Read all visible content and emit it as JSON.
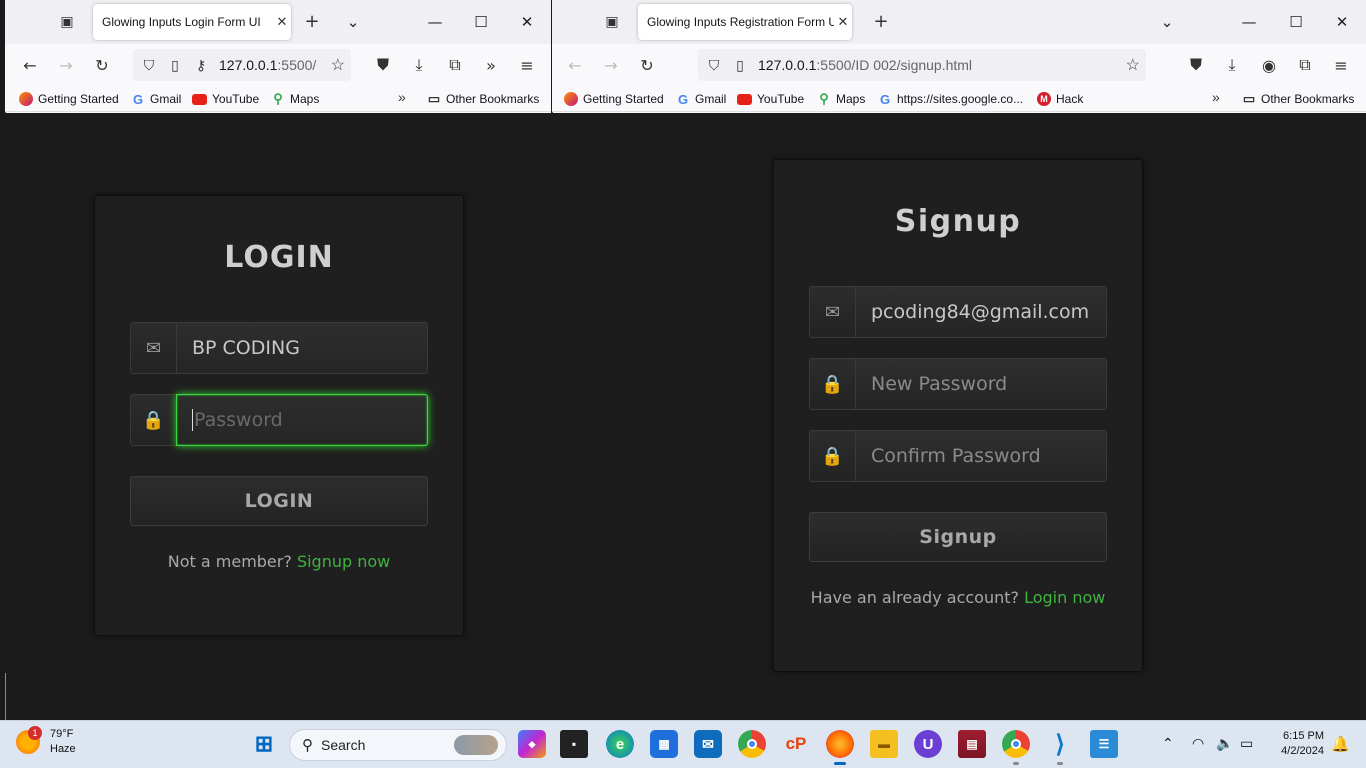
{
  "left_window": {
    "tab_title": "Glowing Inputs Login Form UI",
    "url_host": "127.0.0.1",
    "url_rest": ":5500/",
    "bookmarks": [
      "Getting Started",
      "Gmail",
      "YouTube",
      "Maps"
    ],
    "other_bookmarks": "Other Bookmarks",
    "form": {
      "title": "LOGIN",
      "username_value": "BP CODING",
      "password_placeholder": "Password",
      "button_label": "LOGIN",
      "footer_text": "Not a member? ",
      "footer_link": "Signup now"
    }
  },
  "right_window": {
    "tab_title": "Glowing Inputs Registration Form UI",
    "url_host": "127.0.0.1",
    "url_rest": ":5500/ID 002/signup.html",
    "bookmarks": [
      "Getting Started",
      "Gmail",
      "YouTube",
      "Maps",
      "https://sites.google.co...",
      "Hack"
    ],
    "other_bookmarks": "Other Bookmarks",
    "form": {
      "title": "Signup",
      "email_value": "pcoding84@gmail.com",
      "new_password_placeholder": "New Password",
      "confirm_password_placeholder": "Confirm Password",
      "button_label": "Signup",
      "footer_text": "Have an already account? ",
      "footer_link": "Login now"
    }
  },
  "taskbar": {
    "weather_temp": "79°F",
    "weather_desc": "Haze",
    "weather_badge": "1",
    "search_label": "Search",
    "time": "6:15 PM",
    "date": "4/2/2024"
  },
  "colors": {
    "accent_green": "#3fb33f",
    "glow_green": "#2ecc2e",
    "page_bg": "#1b1b1b"
  }
}
